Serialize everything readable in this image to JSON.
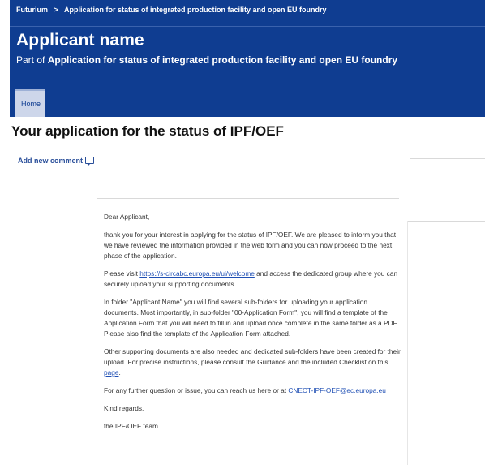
{
  "breadcrumb": {
    "root": "Futurium",
    "separator": ">",
    "current": "Application for status of integrated production facility and open EU foundry"
  },
  "header": {
    "title": "Applicant name",
    "partof_prefix": "Part of",
    "partof_link": "Application for status of integrated production facility and open EU foundry"
  },
  "tabs": [
    {
      "label": "Home"
    }
  ],
  "page": {
    "heading": "Your application for the status of IPF/OEF",
    "add_comment_label": "Add new comment"
  },
  "letter": {
    "greeting": "Dear Applicant,",
    "p1": "thank you for your interest in applying for the status of IPF/OEF. We are pleased to inform you that we have reviewed the information provided in the web form and you can now proceed to the next phase of the application.",
    "p2_before": "Please visit",
    "p2_link": "https://s-circabc.europa.eu/ui/welcome",
    "p2_after": "and access the dedicated group where you can securely upload your supporting documents.",
    "p3": "In folder \"Applicant Name\" you will find several sub-folders for uploading your application documents. Most importantly, in sub-folder \"00-Application Form\", you will find a template of the Application Form that you will need to fill in and upload once complete in the same folder as a PDF. Please also find the template of the Application Form attached.",
    "p4_before": "Other supporting documents are also needed and dedicated sub-folders have been created for their upload. For precise instructions, please consult the Guidance and the included Checklist on this",
    "p4_link": "page",
    "p4_after": ".",
    "p5_before": "For any further question or issue, you can reach us here or at",
    "p5_link": "CNECT-IPF-OEF@ec.europa.eu",
    "closing": "Kind regards,",
    "signature": "the IPF/OEF team"
  }
}
